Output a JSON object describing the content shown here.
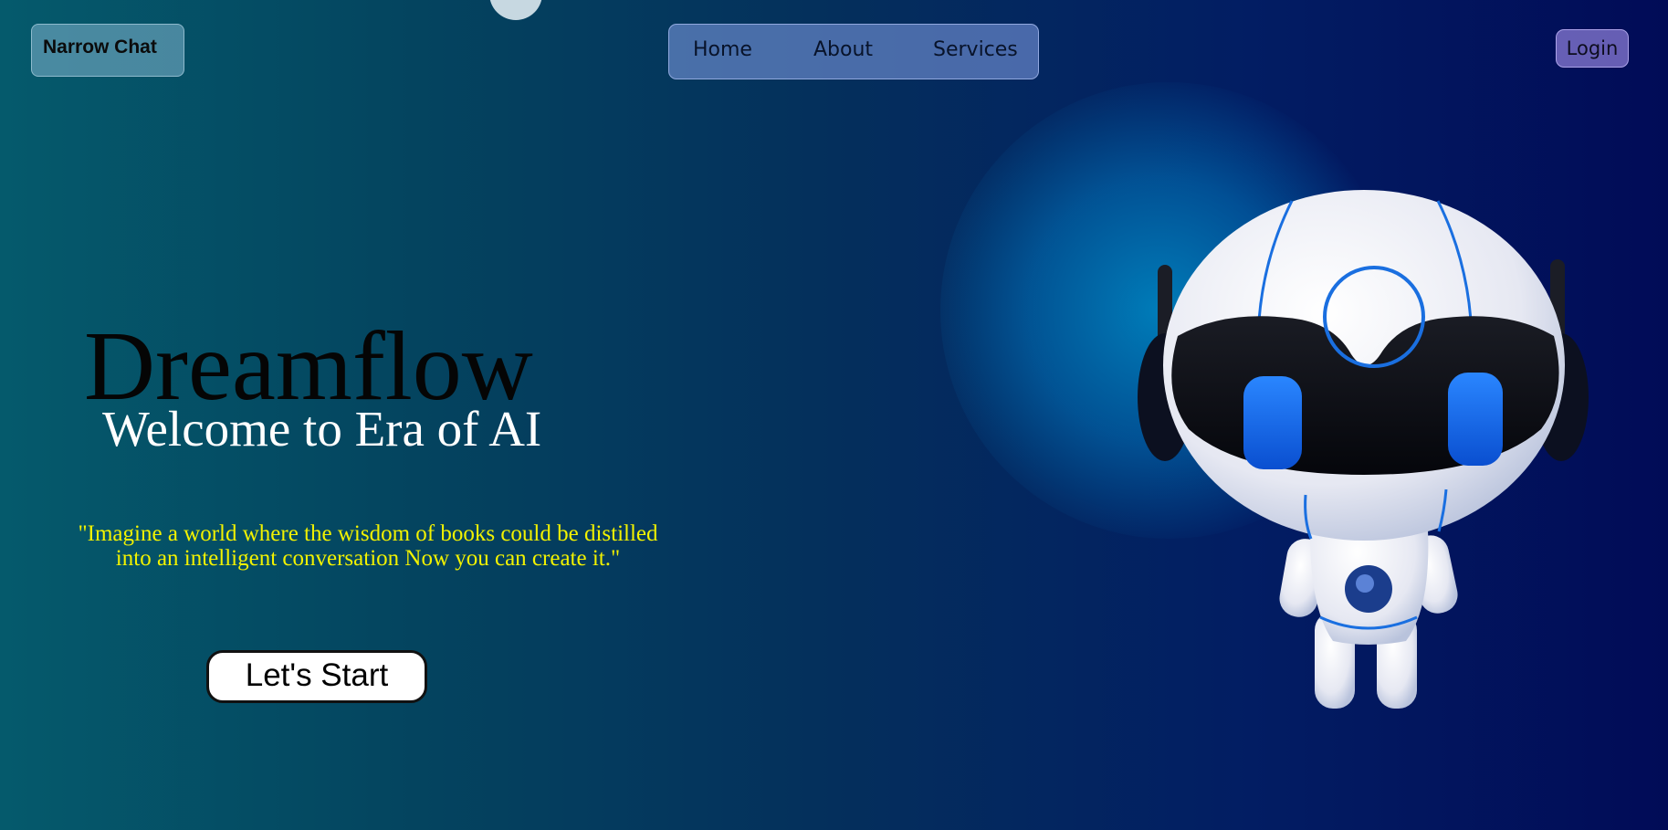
{
  "brand": {
    "label": "Narrow Chat"
  },
  "nav": {
    "items": [
      "Home",
      "About",
      "Services"
    ]
  },
  "login": {
    "label": "Login"
  },
  "hero": {
    "title": "Dreamflow",
    "subtitle": "Welcome to Era of AI",
    "quote_line1": "\"Imagine a world where the wisdom of books could be distilled",
    "quote_line2": "into an intelligent conversation Now you can create it.\"",
    "cta_label": "Let's Start"
  },
  "icons": {
    "robot": "robot-mascot-illustration"
  },
  "colors": {
    "quote": "#f2f200",
    "subtitle": "#ffffff",
    "accent_blue": "#1a6fe0",
    "background_start": "#055a6c",
    "background_end": "#010b57"
  }
}
